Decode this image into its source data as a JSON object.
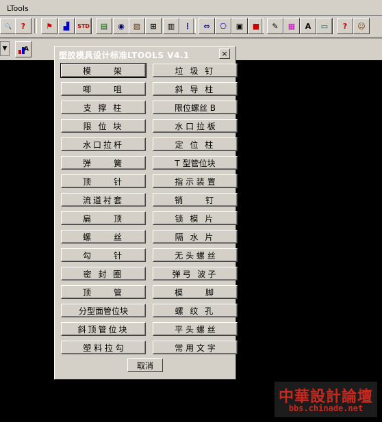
{
  "app": {
    "title": "LTools"
  },
  "toolbar_icons": [
    {
      "name": "zoom-icon",
      "glyph": "🔍",
      "color": "#000000"
    },
    {
      "name": "help-icon",
      "glyph": "?",
      "color": "#cc0000"
    },
    {
      "name": "tool-a-icon",
      "glyph": "⚑",
      "color": "#cc0000"
    },
    {
      "name": "tool-b-icon",
      "glyph": "▟",
      "color": "#0000cc"
    },
    {
      "name": "std-icon",
      "glyph": "STD",
      "color": "#cc0000"
    },
    {
      "name": "tool-c-icon",
      "glyph": "▤",
      "color": "#006600"
    },
    {
      "name": "tool-d-icon",
      "glyph": "◉",
      "color": "#000066"
    },
    {
      "name": "tool-e-icon",
      "glyph": "▨",
      "color": "#663300"
    },
    {
      "name": "tool-f-icon",
      "glyph": "⊞",
      "color": "#000000"
    },
    {
      "name": "tool-g-icon",
      "glyph": "▥",
      "color": "#000000"
    },
    {
      "name": "tool-h-icon",
      "glyph": "⋮",
      "color": "#0000cc"
    },
    {
      "name": "tool-i-icon",
      "glyph": "⇔",
      "color": "#0000cc"
    },
    {
      "name": "tool-j-icon",
      "glyph": "⎔",
      "color": "#0000cc"
    },
    {
      "name": "tool-k-icon",
      "glyph": "▣",
      "color": "#000000"
    },
    {
      "name": "tool-l-icon",
      "glyph": "■",
      "color": "#cc0000"
    },
    {
      "name": "tool-m-icon",
      "glyph": "✎",
      "color": "#000000"
    },
    {
      "name": "tool-n-icon",
      "glyph": "▦",
      "color": "#cc00cc"
    },
    {
      "name": "tool-o-icon",
      "glyph": "A",
      "color": "#000000"
    },
    {
      "name": "tool-p-icon",
      "glyph": "▭",
      "color": "#006666"
    },
    {
      "name": "help2-icon",
      "glyph": "?",
      "color": "#cc0000"
    },
    {
      "name": "tool-q-icon",
      "glyph": "☺",
      "color": "#663300"
    }
  ],
  "dialog": {
    "title": "塑胶模具设计标准LTOOLS V4.1",
    "close": "×",
    "left_buttons": [
      "模　　架",
      "唧　　咀",
      "支 撑 柱",
      "限 位 块",
      "水口拉杆",
      "弹　　簧",
      "顶　　针",
      "流道衬套",
      "扁　　顶",
      "螺　　丝",
      "勾　　针",
      "密 封 圈",
      "顶　　管",
      "分型面管位块",
      "斜顶管位块",
      "塑 料 拉 勾"
    ],
    "right_buttons": [
      "垃 圾 钉",
      "斜 导 柱",
      "限位螺丝 B",
      "水 口 拉 板",
      "定 位 柱",
      "T 型管位块",
      "指 示 装 置",
      "销　　钉",
      "锁 模 片",
      "隔 水 片",
      "无 头 螺 丝",
      "弹弓 波子",
      "模　　脚",
      "螺 纹 孔",
      "平 头 螺 丝",
      "常 用 文 字"
    ],
    "cancel": "取消"
  },
  "watermark": {
    "line1": "中華設計論壇",
    "line2": "bbs.chinade.net"
  }
}
